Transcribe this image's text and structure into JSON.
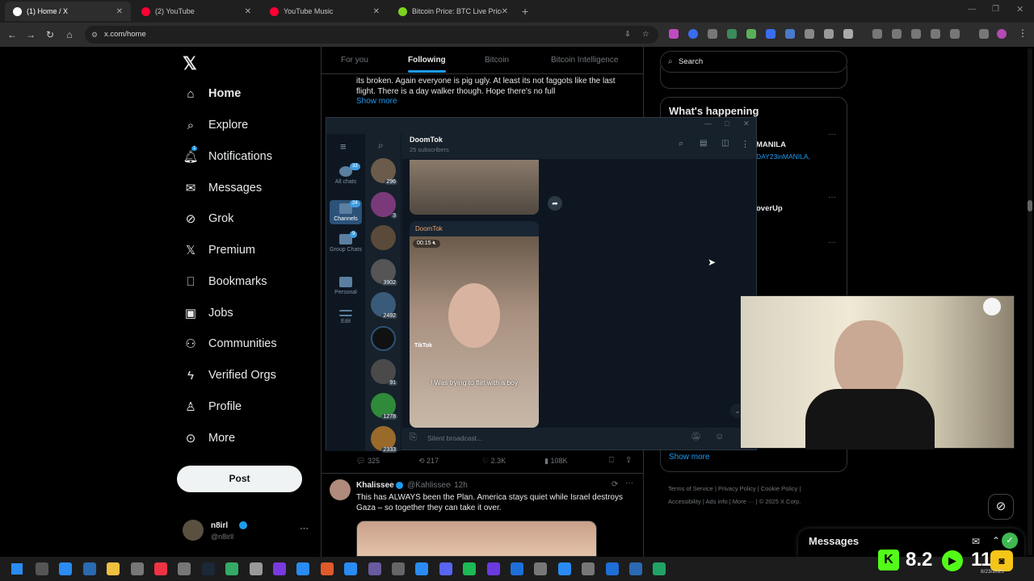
{
  "tabs": [
    {
      "title": "(1) Home / X",
      "fav": "x-icon",
      "color": "#ffffff"
    },
    {
      "title": "(2) YouTube",
      "fav": "youtube-icon",
      "color": "#ff0033"
    },
    {
      "title": "YouTube Music",
      "fav": "youtube-music-icon",
      "color": "#ff0033"
    },
    {
      "title": "Bitcoin Price: BTC Live Price Chart",
      "fav": "bitcoin-icon",
      "color": "#7ed321"
    }
  ],
  "address": {
    "url": "x.com/home"
  },
  "sidebar": {
    "items": [
      {
        "label": "Home",
        "icon": "home-icon"
      },
      {
        "label": "Explore",
        "icon": "search-icon"
      },
      {
        "label": "Notifications",
        "icon": "bell-icon",
        "badge": "1"
      },
      {
        "label": "Messages",
        "icon": "mail-icon"
      },
      {
        "label": "Grok",
        "icon": "grok-icon"
      },
      {
        "label": "Premium",
        "icon": "x-logo-icon"
      },
      {
        "label": "Bookmarks",
        "icon": "bookmark-icon"
      },
      {
        "label": "Jobs",
        "icon": "briefcase-icon"
      },
      {
        "label": "Communities",
        "icon": "people-icon"
      },
      {
        "label": "Verified Orgs",
        "icon": "lightning-icon"
      },
      {
        "label": "Profile",
        "icon": "person-icon"
      },
      {
        "label": "More",
        "icon": "more-circle-icon"
      }
    ],
    "post": "Post",
    "user": {
      "name": "n8irl",
      "handle": "@n8irll"
    }
  },
  "feed": {
    "tabs": [
      "For you",
      "Following",
      "Bitcoin",
      "Bitcoin Intelligence"
    ],
    "tweet1": {
      "text": "its broken. Again everyone is pig ugly. At least its not faggots like the last flight. There is a day walker though. Hope there's no full",
      "show_more": "Show more",
      "stats": {
        "replies": "325",
        "reposts": "217",
        "likes": "2.3K",
        "views": "108K"
      }
    },
    "tweet2": {
      "name": "Khalissee",
      "handle": "@Kahlissee",
      "time": "12h",
      "text": "This has ALWAYS been the Plan. America stays quiet while Israel destroys Gaza – so together they can take it over."
    }
  },
  "right": {
    "search_placeholder": "Search",
    "whats_happening": "What's happening",
    "trend1": "MANILA",
    "trend1_sub": "DAY23inMANILA,",
    "trend2": "overUp",
    "show_more": "Show more",
    "footer": [
      "Terms of Service",
      "Privacy Policy",
      "Cookie Policy",
      "Accessibility",
      "Ads info",
      "More ···",
      "© 2025 X Corp."
    ],
    "messages": "Messages"
  },
  "telegram": {
    "channel": "DoomTok",
    "subscribers": "25 subscribers",
    "sender": "DoomTok",
    "duration": "00:15",
    "tiktok": "TikTok",
    "caption": "I Was trying to flirt with a boy",
    "input_placeholder": "Silent broadcast...",
    "folders": [
      {
        "label": "All chats",
        "badge": "33"
      },
      {
        "label": "Channels",
        "badge": "24"
      },
      {
        "label": "Group Chats",
        "badge": "9"
      },
      {
        "label": "Personal",
        "badge": ""
      },
      {
        "label": "Edit",
        "badge": ""
      }
    ],
    "chats": [
      {
        "count": "296",
        "color": "#6b5b4a"
      },
      {
        "count": "3",
        "color": "#7a3a7a"
      },
      {
        "count": "",
        "color": "#5a4a3a"
      },
      {
        "count": "3902",
        "color": "#555"
      },
      {
        "count": "2492",
        "color": "#3a5a7a"
      },
      {
        "count": "",
        "color": "#111"
      },
      {
        "count": "91",
        "color": "#4a4a4a"
      },
      {
        "count": "1278",
        "color": "#2f8a3a"
      },
      {
        "count": "2333",
        "color": "#9a6a2a"
      }
    ]
  },
  "taskbar": {
    "time": "11",
    "date": "8/23/2025",
    "counter": "8.2"
  }
}
